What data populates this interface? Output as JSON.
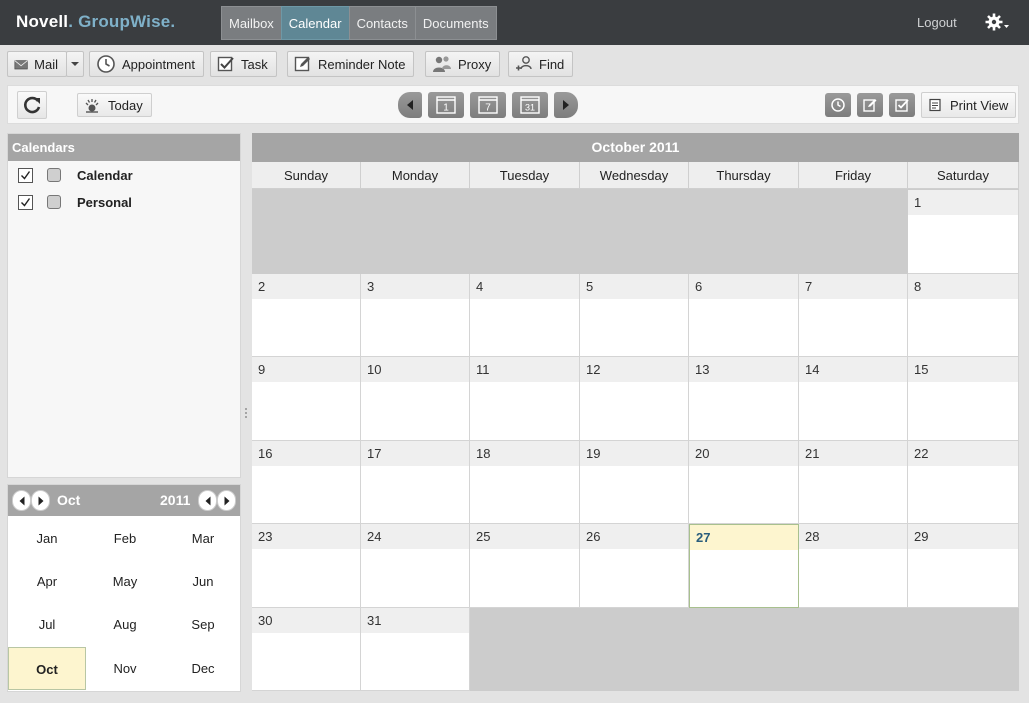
{
  "app": {
    "brand_a": "Novell",
    "brand_b": "GroupWise",
    "brand_dot": ".",
    "tabs": [
      {
        "label": "Mailbox",
        "active": false
      },
      {
        "label": "Calendar",
        "active": true
      },
      {
        "label": "Contacts",
        "active": false
      },
      {
        "label": "Documents",
        "active": false
      }
    ],
    "logout": "Logout",
    "settings_icon": "gear-icon"
  },
  "toolbar": {
    "mail": "Mail",
    "appointment": "Appointment",
    "task": "Task",
    "reminder_note": "Reminder Note",
    "proxy": "Proxy",
    "find": "Find"
  },
  "navbar": {
    "today": "Today",
    "day_view_num": "1",
    "week_view_num": "7",
    "month_view_num": "31",
    "print_view": "Print View"
  },
  "calendars": {
    "title": "Calendars",
    "items": [
      {
        "name": "Calendar",
        "checked": true,
        "color": "#cfcfcf"
      },
      {
        "name": "Personal",
        "checked": true,
        "color": "#cfcfcf"
      }
    ]
  },
  "minical": {
    "month": "Oct",
    "year": "2011",
    "months": [
      "Jan",
      "Feb",
      "Mar",
      "Apr",
      "May",
      "Jun",
      "Jul",
      "Aug",
      "Sep",
      "Oct",
      "Nov",
      "Dec"
    ],
    "selected_month": "Oct"
  },
  "monthview": {
    "title": "October 2011",
    "weekdays": [
      "Sunday",
      "Monday",
      "Tuesday",
      "Wednesday",
      "Thursday",
      "Friday",
      "Saturday"
    ],
    "days": [
      "1",
      "2",
      "3",
      "4",
      "5",
      "6",
      "7",
      "8",
      "9",
      "10",
      "11",
      "12",
      "13",
      "14",
      "15",
      "16",
      "17",
      "18",
      "19",
      "20",
      "21",
      "22",
      "23",
      "24",
      "25",
      "26",
      "27",
      "28",
      "29",
      "30",
      "31"
    ],
    "first_weekday": "Saturday",
    "today": "27"
  },
  "colors": {
    "topbar": "#3a3d40",
    "active_tab": "#5f8795",
    "brand_accent": "#7fb1c9",
    "header_gray": "#a5a5a5",
    "today_highlight": "#fdf5cf"
  }
}
